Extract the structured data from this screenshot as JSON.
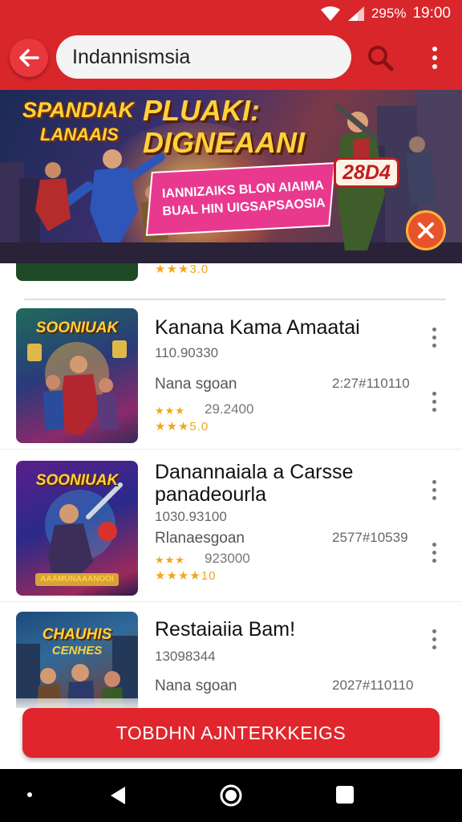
{
  "status_bar": {
    "battery": "295%",
    "time": "19:00"
  },
  "search": {
    "value": "Indannismsia"
  },
  "banner": {
    "title_left_line1": "SPANDIAK",
    "title_left_line2": "LANAAIS",
    "headline": "PLUAKI: DIGNEAANI",
    "pill_line1": "IANNIZAIKS BLON AIAIMA",
    "pill_line2": "BUAL HIN UIGSAPSAOSIA",
    "year": "28D4"
  },
  "previous_item": {
    "rating": "★★★3.0"
  },
  "apps": [
    {
      "thumb_title": "SOONIUAK",
      "thumb_sub": "",
      "title": "Kanana Kama Amaatai",
      "id": "110.90330",
      "developer": "Nana sgoan",
      "meta": "2:27#110110",
      "stars": "★★★",
      "count": "29.2400",
      "rating": "★★★5.0"
    },
    {
      "thumb_title": "SOONIUAK",
      "thumb_sub": "AAAMUNAAANOOI",
      "title": "Danannaiala a Carsse panadeourla",
      "id": "1030.93100",
      "developer": "Rlanaesgoan",
      "meta": "2577#10539",
      "stars": "★★★",
      "count": "923000",
      "rating": "★★★★10"
    },
    {
      "thumb_title": "CHAUHIS",
      "thumb_sub": "CENHES",
      "title": "Restaiaiia Bam!",
      "id": "13098344",
      "developer": "Nana sgoan",
      "meta": "2027#110110",
      "stars": "",
      "count": "",
      "rating": ""
    }
  ],
  "cta": {
    "label": "TOBDHN AJNTERKKEIGS"
  },
  "colors": {
    "accent": "#d9262b",
    "cta": "#e0262c",
    "star": "#f2a51b"
  },
  "icons": [
    "arrow-left-icon",
    "search-icon",
    "more-vert-icon",
    "wifi-icon",
    "signal-icon",
    "close-icon",
    "nav-back-icon",
    "nav-home-icon",
    "nav-recent-icon"
  ]
}
